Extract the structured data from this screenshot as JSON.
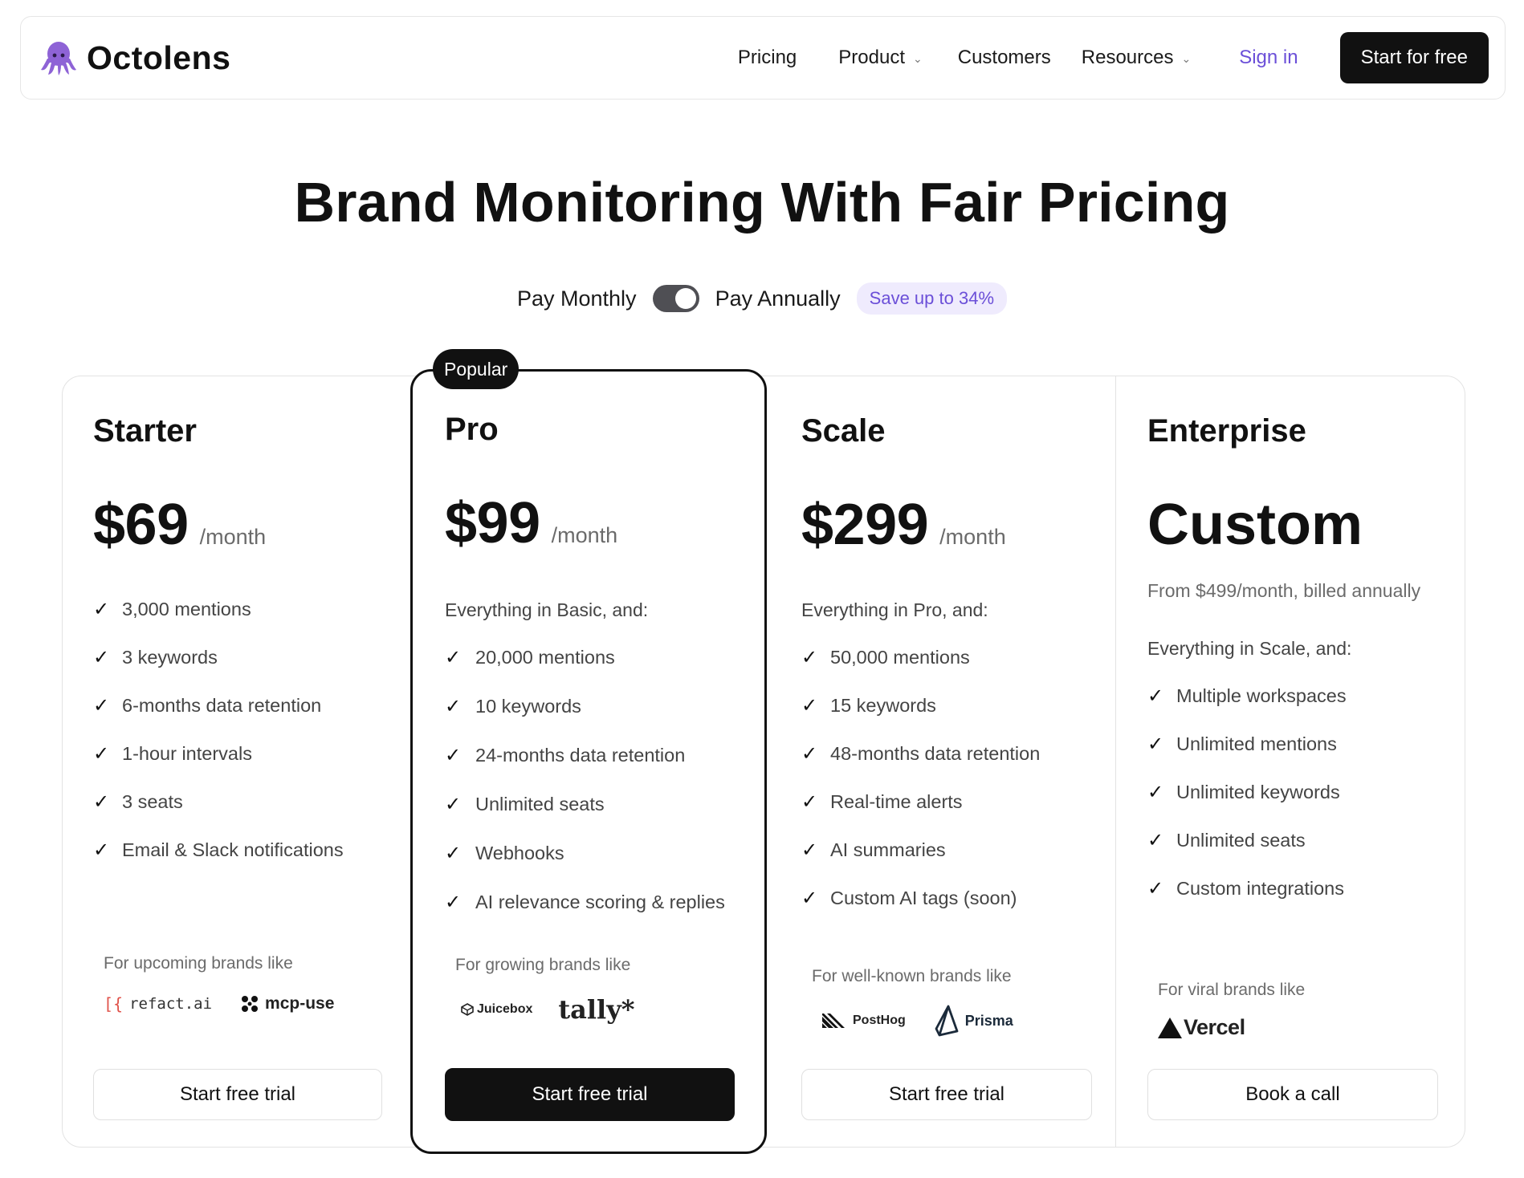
{
  "nav": {
    "brand": "Octolens",
    "brand_icon": "octopus-logo-icon",
    "links": {
      "pricing": "Pricing",
      "product": "Product",
      "customers": "Customers",
      "resources": "Resources"
    },
    "sign_in": "Sign in",
    "cta": "Start for free"
  },
  "hero": {
    "title": "Brand Monitoring With Fair Pricing",
    "pay_monthly": "Pay Monthly",
    "pay_annually": "Pay Annually",
    "save_badge": "Save up to 34%",
    "toggle_state": "annually"
  },
  "plans": {
    "starter": {
      "name": "Starter",
      "price": "$69",
      "per": "/month",
      "features": [
        "3,000 mentions",
        "3 keywords",
        "6-months data retention",
        "1-hour intervals",
        "3 seats",
        "Email & Slack notifications"
      ],
      "brands_label": "For upcoming brands like",
      "brand_logos": [
        "refact.ai",
        "mcp-use"
      ],
      "cta": "Start free trial"
    },
    "pro": {
      "badge": "Popular",
      "name": "Pro",
      "price": "$99",
      "per": "/month",
      "intro": "Everything in Basic, and:",
      "features": [
        "20,000 mentions",
        "10 keywords",
        "24-months data retention",
        "Unlimited seats",
        "Webhooks",
        "AI relevance scoring & replies"
      ],
      "brands_label": "For growing brands like",
      "brand_logos": [
        "Juicebox",
        "tally*"
      ],
      "cta": "Start free trial"
    },
    "scale": {
      "name": "Scale",
      "price": "$299",
      "per": "/month",
      "intro": "Everything in Pro, and:",
      "features": [
        "50,000 mentions",
        "15 keywords",
        "48-months data retention",
        "Real-time alerts",
        "AI summaries",
        "Custom AI tags (soon)"
      ],
      "brands_label": "For well-known brands like",
      "brand_logos": [
        "PostHog",
        "Prisma"
      ],
      "cta": "Start free trial"
    },
    "enterprise": {
      "name": "Enterprise",
      "price": "Custom",
      "from_note": "From $499/month, billed annually",
      "intro": "Everything in Scale, and:",
      "features": [
        "Multiple workspaces",
        "Unlimited mentions",
        "Unlimited keywords",
        "Unlimited seats",
        "Custom integrations"
      ],
      "brands_label": "For viral brands like",
      "brand_logos": [
        "Vercel"
      ],
      "cta": "Book a call"
    }
  },
  "colors": {
    "accent": "#6b4fd8",
    "dark": "#111111",
    "badge_bg": "#efebfd",
    "octopus": "#8e63d6"
  }
}
